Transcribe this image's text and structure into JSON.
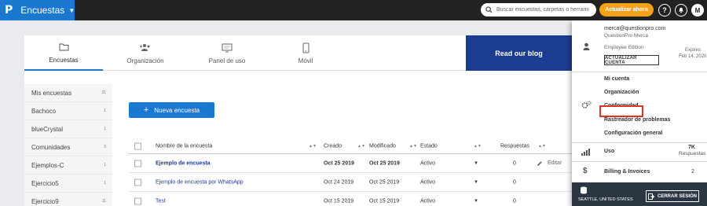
{
  "topbar": {
    "logo": "P",
    "app_title": "Encuestas",
    "search_placeholder": "Buscar encuestas, carpetas o herrami",
    "upgrade_label": "Actualizar ahora",
    "help_label": "?",
    "avatar_label": "M"
  },
  "tabs": [
    {
      "label": "Encuestas",
      "icon": "folder-icon"
    },
    {
      "label": "Organización",
      "icon": "users-add-icon"
    },
    {
      "label": "Panel de uso",
      "icon": "monitor-icon"
    },
    {
      "label": "Móvil",
      "icon": "phone-icon"
    }
  ],
  "blog_label": "Read our blog",
  "sidebar": {
    "items": [
      {
        "label": "Mis encuestas",
        "count": "21"
      },
      {
        "label": "Bachoco",
        "count": "1"
      },
      {
        "label": "blueCrystal",
        "count": "1"
      },
      {
        "label": "Comunidades",
        "count": "3"
      },
      {
        "label": "Ejemplos-C",
        "count": "1"
      },
      {
        "label": "Ejercicio5",
        "count": "1"
      },
      {
        "label": "Ejercicio9",
        "count": "11"
      }
    ]
  },
  "new_survey_label": "Nueva encuesta",
  "table": {
    "headers": {
      "name": "Nombre de la encuesta",
      "created": "Creado",
      "modified": "Modificado",
      "status": "Estado",
      "responses": "Respuestas"
    },
    "rows": [
      {
        "name": "Ejemplo de encuesta",
        "created": "Oct 25 2019",
        "modified": "Oct 25 2019",
        "status": "Activo",
        "responses": "0",
        "edit": "Editar"
      },
      {
        "name": "Ejemplo de encuesta por WhatsApp",
        "created": "Oct 24 2019",
        "modified": "Oct 25 2019",
        "status": "Activo",
        "responses": "0",
        "edit": ""
      },
      {
        "name": "Test",
        "created": "Oct 15 2019",
        "modified": "Oct 15 2019",
        "status": "Activo",
        "responses": "0",
        "edit": ""
      }
    ]
  },
  "account_menu": {
    "email": "merca@questionpro.com",
    "org": "QuestionPro Merca",
    "edition": "Employee Edition",
    "expires_label": "Expires",
    "expires_date": "Feb 14, 2020",
    "upgrade_account": "ACTUALIZAR CUENTA",
    "items": [
      "Mi cuenta",
      "Organización",
      "Conformidad",
      "Rastreador de problemas",
      "Configuración general"
    ],
    "usage_label": "Uso",
    "usage_value": "7K",
    "usage_unit": "Respuestas",
    "billing_label": "Billing & Invoices",
    "billing_count": "2",
    "location": "SEATTLE, UNITED STATES",
    "logout_label": "CERRAR SESIÓN"
  },
  "colors": {
    "brand_blue": "#1b78d0",
    "topbar": "#222222",
    "upgrade_orange": "#f7a11a",
    "blog_navy": "#1c3d8f",
    "highlight_red": "#e0341f"
  }
}
